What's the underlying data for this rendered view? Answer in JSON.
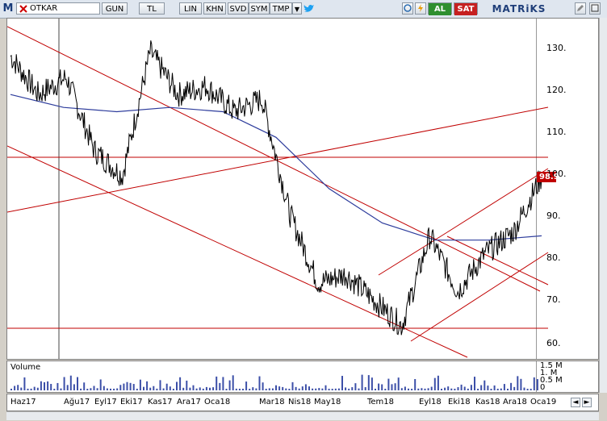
{
  "toolbar": {
    "menu_glyph": "M",
    "symbol": "OTKAR",
    "buttons": [
      "GUN",
      "TL",
      "LIN",
      "KHN",
      "SVD",
      "SYM",
      "TMP"
    ],
    "dropdown_glyph": "▼",
    "buy_label": "AL",
    "sell_label": "SAT",
    "logo": "MATRiKS",
    "icons": [
      "twitter-icon",
      "refresh-icon",
      "lightning-icon",
      "edit-icon",
      "maximize-icon"
    ]
  },
  "price_axis": {
    "ticks": [
      "130.",
      "120.",
      "110.",
      "100.",
      "98.9",
      "90.",
      "80.",
      "70.",
      "60."
    ]
  },
  "volume_panel": {
    "label": "Volume",
    "ticks": [
      "1.5 M",
      "1. M",
      "0.5 M",
      "0"
    ]
  },
  "time_axis": {
    "labels": [
      "Haz17",
      "Ağu17",
      "Eyl17",
      "Eki17",
      "Kas17",
      "Ara17",
      "Oca18",
      "Mar18",
      "Nis18",
      "May18",
      "Tem18",
      "Eyl18",
      "Eki18",
      "Kas18",
      "Ara18",
      "Oca19"
    ]
  },
  "chart_data": {
    "type": "line",
    "title": "",
    "series": [
      {
        "name": "",
        "kind": "price",
        "x": [
          "Haz17",
          "Tem17",
          "Ağu17",
          "Eyl17",
          "Eki17",
          "Kas17",
          "Ara17",
          "Oca18",
          "Şub18",
          "Mar18",
          "Nis18",
          "May18",
          "Haz18",
          "Tem18",
          "Ağu18",
          "Eyl18",
          "Eki18",
          "Kas18",
          "Ara18",
          "Oca19"
        ],
        "values": [
          127,
          118,
          122,
          105,
          99,
          128,
          118,
          120,
          114,
          117,
          90,
          74,
          76,
          70,
          64,
          85,
          72,
          81,
          86,
          98.9
        ]
      },
      {
        "name": "",
        "kind": "moving-average",
        "x": [
          "Haz17",
          "Ağu17",
          "Eki17",
          "Ara17",
          "Şub18",
          "Nis18",
          "Haz18",
          "Ağu18",
          "Eki18",
          "Ara18",
          "Oca19"
        ],
        "values": [
          118,
          115,
          114,
          115,
          114,
          108,
          96,
          88,
          84,
          84,
          85
        ]
      }
    ],
    "volume": {
      "approx_max": 1500000
    },
    "yrange": [
      57,
      135
    ],
    "last_value": 98.9,
    "trendlines": "red support, resistance and channel lines drawn over the price",
    "colors": {
      "price": "#000000",
      "moving_average": "#2d3c9c",
      "trendline": "#c00000",
      "last_price_box": "#c00000"
    },
    "grid": false
  }
}
